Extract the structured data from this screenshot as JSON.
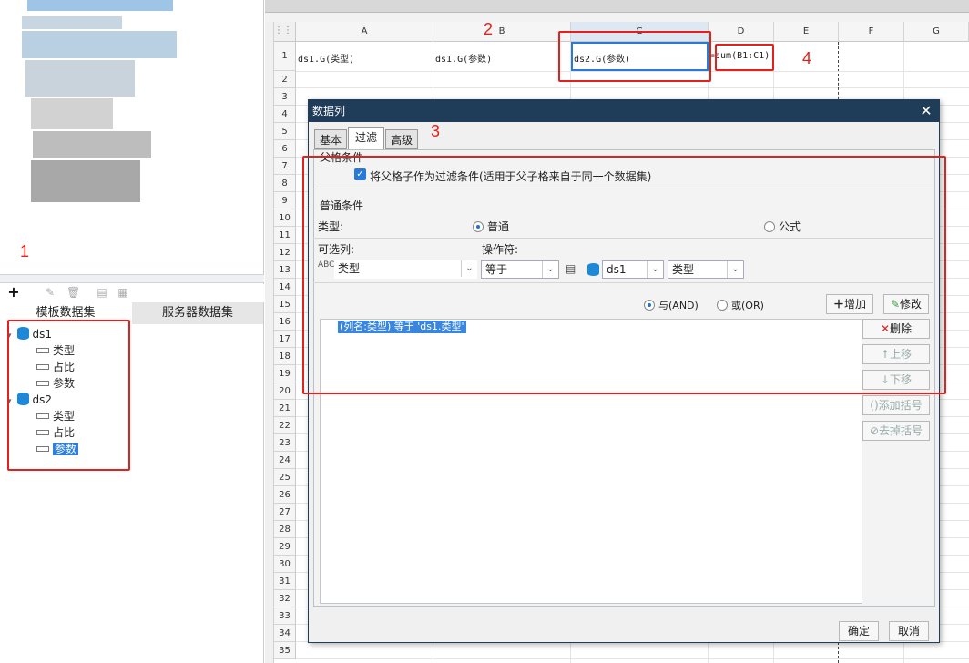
{
  "left_panel": {
    "tabs": [
      "模板数据集",
      "服务器数据集"
    ],
    "datasets": [
      {
        "name": "ds1",
        "fields": [
          "类型",
          "占比",
          "参数"
        ]
      },
      {
        "name": "ds2",
        "fields": [
          "类型",
          "占比",
          "参数"
        ]
      }
    ],
    "selected_field": "参数",
    "toolbar_icons": [
      "add-icon",
      "edit-icon",
      "delete-icon",
      "preview-icon",
      "param-icon"
    ]
  },
  "sheet": {
    "columns": [
      "A",
      "B",
      "C",
      "D",
      "E",
      "F",
      "G"
    ],
    "rows": [
      "1",
      "2",
      "3",
      "4",
      "5",
      "6",
      "7",
      "8",
      "9",
      "10",
      "11",
      "12",
      "13",
      "14",
      "15",
      "16",
      "17",
      "18",
      "19",
      "20",
      "21",
      "22",
      "23",
      "24",
      "25",
      "26",
      "27",
      "28",
      "29",
      "30",
      "31",
      "32",
      "33",
      "34",
      "35"
    ],
    "cells": {
      "A1": "ds1.G(类型)",
      "B1": "ds1.G(参数)",
      "C1": "ds2.G(参数)",
      "D1": "=sum(B1:C1)"
    }
  },
  "annotations": [
    "1",
    "2",
    "3",
    "4"
  ],
  "dialog": {
    "title": "数据列",
    "tabs": [
      "基本",
      "过滤",
      "高级"
    ],
    "active_tab": "过滤",
    "parent_section": "父格条件",
    "parent_checkbox": "将父格子作为过滤条件(适用于父子格来自于同一个数据集)",
    "normal_section": "普通条件",
    "type_label": "类型:",
    "type_options": [
      "普通",
      "公式"
    ],
    "column_label": "可选列:",
    "operator_label": "操作符:",
    "column_value": "类型",
    "operator_value": "等于",
    "dataset_value": "ds1",
    "field_value": "类型",
    "logic_options": [
      "与(AND)",
      "或(OR)"
    ],
    "add_button": "增加",
    "modify_button": "修改",
    "delete_button": "删除",
    "up_button": "上移",
    "down_button": "下移",
    "add_bracket_button": "添加括号",
    "remove_bracket_button": "去掉括号",
    "condition": "(列名:类型) 等于 'ds1.类型'",
    "ok": "确定",
    "cancel": "取消"
  }
}
